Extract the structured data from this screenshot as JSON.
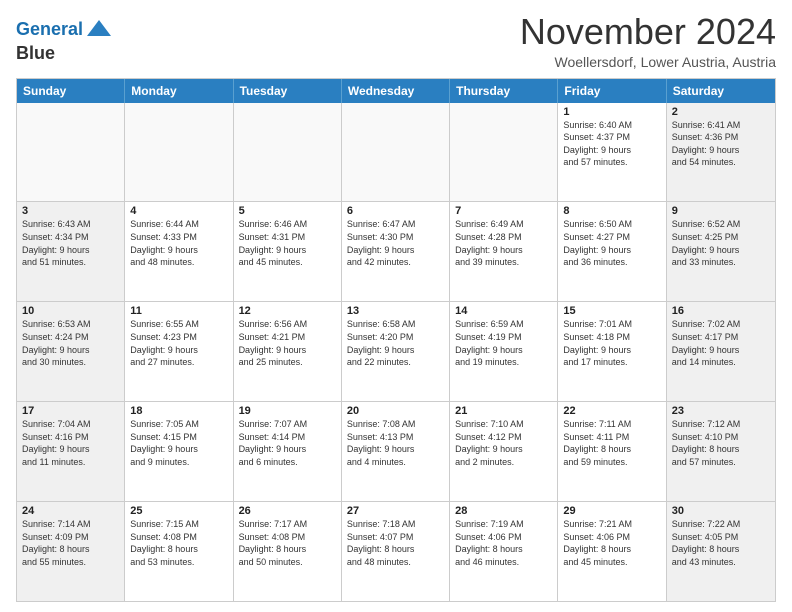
{
  "logo": {
    "line1": "General",
    "line2": "Blue"
  },
  "title": "November 2024",
  "subtitle": "Woellersdorf, Lower Austria, Austria",
  "days_of_week": [
    "Sunday",
    "Monday",
    "Tuesday",
    "Wednesday",
    "Thursday",
    "Friday",
    "Saturday"
  ],
  "weeks": [
    [
      {
        "num": "",
        "info": "",
        "empty": true
      },
      {
        "num": "",
        "info": "",
        "empty": true
      },
      {
        "num": "",
        "info": "",
        "empty": true
      },
      {
        "num": "",
        "info": "",
        "empty": true
      },
      {
        "num": "",
        "info": "",
        "empty": true
      },
      {
        "num": "1",
        "info": "Sunrise: 6:40 AM\nSunset: 4:37 PM\nDaylight: 9 hours\nand 57 minutes.",
        "empty": false
      },
      {
        "num": "2",
        "info": "Sunrise: 6:41 AM\nSunset: 4:36 PM\nDaylight: 9 hours\nand 54 minutes.",
        "empty": false
      }
    ],
    [
      {
        "num": "3",
        "info": "Sunrise: 6:43 AM\nSunset: 4:34 PM\nDaylight: 9 hours\nand 51 minutes.",
        "empty": false
      },
      {
        "num": "4",
        "info": "Sunrise: 6:44 AM\nSunset: 4:33 PM\nDaylight: 9 hours\nand 48 minutes.",
        "empty": false
      },
      {
        "num": "5",
        "info": "Sunrise: 6:46 AM\nSunset: 4:31 PM\nDaylight: 9 hours\nand 45 minutes.",
        "empty": false
      },
      {
        "num": "6",
        "info": "Sunrise: 6:47 AM\nSunset: 4:30 PM\nDaylight: 9 hours\nand 42 minutes.",
        "empty": false
      },
      {
        "num": "7",
        "info": "Sunrise: 6:49 AM\nSunset: 4:28 PM\nDaylight: 9 hours\nand 39 minutes.",
        "empty": false
      },
      {
        "num": "8",
        "info": "Sunrise: 6:50 AM\nSunset: 4:27 PM\nDaylight: 9 hours\nand 36 minutes.",
        "empty": false
      },
      {
        "num": "9",
        "info": "Sunrise: 6:52 AM\nSunset: 4:25 PM\nDaylight: 9 hours\nand 33 minutes.",
        "empty": false
      }
    ],
    [
      {
        "num": "10",
        "info": "Sunrise: 6:53 AM\nSunset: 4:24 PM\nDaylight: 9 hours\nand 30 minutes.",
        "empty": false
      },
      {
        "num": "11",
        "info": "Sunrise: 6:55 AM\nSunset: 4:23 PM\nDaylight: 9 hours\nand 27 minutes.",
        "empty": false
      },
      {
        "num": "12",
        "info": "Sunrise: 6:56 AM\nSunset: 4:21 PM\nDaylight: 9 hours\nand 25 minutes.",
        "empty": false
      },
      {
        "num": "13",
        "info": "Sunrise: 6:58 AM\nSunset: 4:20 PM\nDaylight: 9 hours\nand 22 minutes.",
        "empty": false
      },
      {
        "num": "14",
        "info": "Sunrise: 6:59 AM\nSunset: 4:19 PM\nDaylight: 9 hours\nand 19 minutes.",
        "empty": false
      },
      {
        "num": "15",
        "info": "Sunrise: 7:01 AM\nSunset: 4:18 PM\nDaylight: 9 hours\nand 17 minutes.",
        "empty": false
      },
      {
        "num": "16",
        "info": "Sunrise: 7:02 AM\nSunset: 4:17 PM\nDaylight: 9 hours\nand 14 minutes.",
        "empty": false
      }
    ],
    [
      {
        "num": "17",
        "info": "Sunrise: 7:04 AM\nSunset: 4:16 PM\nDaylight: 9 hours\nand 11 minutes.",
        "empty": false
      },
      {
        "num": "18",
        "info": "Sunrise: 7:05 AM\nSunset: 4:15 PM\nDaylight: 9 hours\nand 9 minutes.",
        "empty": false
      },
      {
        "num": "19",
        "info": "Sunrise: 7:07 AM\nSunset: 4:14 PM\nDaylight: 9 hours\nand 6 minutes.",
        "empty": false
      },
      {
        "num": "20",
        "info": "Sunrise: 7:08 AM\nSunset: 4:13 PM\nDaylight: 9 hours\nand 4 minutes.",
        "empty": false
      },
      {
        "num": "21",
        "info": "Sunrise: 7:10 AM\nSunset: 4:12 PM\nDaylight: 9 hours\nand 2 minutes.",
        "empty": false
      },
      {
        "num": "22",
        "info": "Sunrise: 7:11 AM\nSunset: 4:11 PM\nDaylight: 8 hours\nand 59 minutes.",
        "empty": false
      },
      {
        "num": "23",
        "info": "Sunrise: 7:12 AM\nSunset: 4:10 PM\nDaylight: 8 hours\nand 57 minutes.",
        "empty": false
      }
    ],
    [
      {
        "num": "24",
        "info": "Sunrise: 7:14 AM\nSunset: 4:09 PM\nDaylight: 8 hours\nand 55 minutes.",
        "empty": false
      },
      {
        "num": "25",
        "info": "Sunrise: 7:15 AM\nSunset: 4:08 PM\nDaylight: 8 hours\nand 53 minutes.",
        "empty": false
      },
      {
        "num": "26",
        "info": "Sunrise: 7:17 AM\nSunset: 4:08 PM\nDaylight: 8 hours\nand 50 minutes.",
        "empty": false
      },
      {
        "num": "27",
        "info": "Sunrise: 7:18 AM\nSunset: 4:07 PM\nDaylight: 8 hours\nand 48 minutes.",
        "empty": false
      },
      {
        "num": "28",
        "info": "Sunrise: 7:19 AM\nSunset: 4:06 PM\nDaylight: 8 hours\nand 46 minutes.",
        "empty": false
      },
      {
        "num": "29",
        "info": "Sunrise: 7:21 AM\nSunset: 4:06 PM\nDaylight: 8 hours\nand 45 minutes.",
        "empty": false
      },
      {
        "num": "30",
        "info": "Sunrise: 7:22 AM\nSunset: 4:05 PM\nDaylight: 8 hours\nand 43 minutes.",
        "empty": false
      }
    ]
  ]
}
